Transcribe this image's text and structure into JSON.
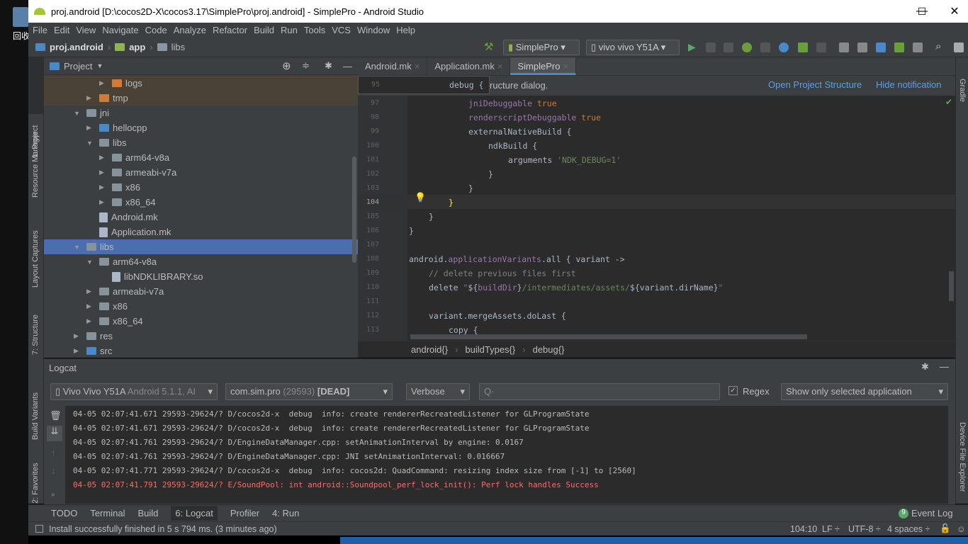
{
  "desktop": {
    "recycle_label": "回收"
  },
  "window": {
    "title": "proj.android [D:\\cocos2D-X\\cocos3.17\\SimplePro\\proj.android] - SimplePro - Android Studio",
    "minimize": "—",
    "maximize": "☐",
    "close": "✕"
  },
  "menu": [
    "File",
    "Edit",
    "View",
    "Navigate",
    "Code",
    "Analyze",
    "Refactor",
    "Build",
    "Run",
    "Tools",
    "VCS",
    "Window",
    "Help"
  ],
  "breadcrumb": [
    "proj.android",
    "app",
    "libs"
  ],
  "toolbar": {
    "config": "SimplePro",
    "device": "vivo vivo Y51A"
  },
  "left_strip": [
    "1: Project",
    "Resource Manager",
    "Layout Captures",
    "7: Structure",
    "Build Variants",
    "2: Favorites"
  ],
  "right_strip": [
    "Gradle",
    "Device File Explorer"
  ],
  "project_panel": {
    "title": "Project",
    "tree": [
      {
        "label": "logs",
        "depth": 2,
        "arrow": "▶",
        "type": "folder-orange"
      },
      {
        "label": "tmp",
        "depth": 1,
        "arrow": "▶",
        "type": "folder-orange"
      },
      {
        "label": "jni",
        "depth": 0,
        "arrow": "▼",
        "type": "folder"
      },
      {
        "label": "hellocpp",
        "depth": 1,
        "arrow": "▶",
        "type": "folder-blue"
      },
      {
        "label": "libs",
        "depth": 1,
        "arrow": "▼",
        "type": "folder"
      },
      {
        "label": "arm64-v8a",
        "depth": 2,
        "arrow": "▶",
        "type": "folder"
      },
      {
        "label": "armeabi-v7a",
        "depth": 2,
        "arrow": "▶",
        "type": "folder"
      },
      {
        "label": "x86",
        "depth": 2,
        "arrow": "▶",
        "type": "folder"
      },
      {
        "label": "x86_64",
        "depth": 2,
        "arrow": "▶",
        "type": "folder"
      },
      {
        "label": "Android.mk",
        "depth": 1,
        "arrow": "",
        "type": "file"
      },
      {
        "label": "Application.mk",
        "depth": 1,
        "arrow": "",
        "type": "file"
      },
      {
        "label": "libs",
        "depth": 0,
        "arrow": "▼",
        "type": "folder",
        "selected": true
      },
      {
        "label": "arm64-v8a",
        "depth": 1,
        "arrow": "▼",
        "type": "folder"
      },
      {
        "label": "libNDKLIBRARY.so",
        "depth": 2,
        "arrow": "",
        "type": "file"
      },
      {
        "label": "armeabi-v7a",
        "depth": 1,
        "arrow": "▶",
        "type": "folder"
      },
      {
        "label": "x86",
        "depth": 1,
        "arrow": "▶",
        "type": "folder"
      },
      {
        "label": "x86_64",
        "depth": 1,
        "arrow": "▶",
        "type": "folder"
      },
      {
        "label": "res",
        "depth": 0,
        "arrow": "▶",
        "type": "folder"
      },
      {
        "label": "src",
        "depth": 0,
        "arrow": "▶",
        "type": "folder-blue"
      }
    ]
  },
  "editor": {
    "tabs": [
      "Android.mk",
      "Application.mk",
      "SimplePro"
    ],
    "active_tab": 2,
    "notification": {
      "text": "ructure dialog.",
      "sticky_line": "95",
      "sticky_code": "debug {",
      "open": "Open Project Structure",
      "hide": "Hide notification"
    },
    "lines": [
      {
        "n": "97",
        "indent": 3,
        "html": "<span class='pr'>jniDebuggable</span> <span class='kw'>true</span>"
      },
      {
        "n": "98",
        "indent": 3,
        "html": "<span class='pr'>renderscriptDebuggable</span> <span class='kw'>true</span>"
      },
      {
        "n": "99",
        "indent": 3,
        "html": "externalNativeBuild {"
      },
      {
        "n": "100",
        "indent": 4,
        "html": "ndkBuild {"
      },
      {
        "n": "101",
        "indent": 5,
        "html": "arguments <span class='st'>'NDK_DEBUG=1'</span>"
      },
      {
        "n": "102",
        "indent": 4,
        "html": "}"
      },
      {
        "n": "103",
        "indent": 3,
        "html": "}"
      },
      {
        "n": "104",
        "indent": 2,
        "html": "<span style='color:#ffef28'>}</span>"
      },
      {
        "n": "105",
        "indent": 1,
        "html": "}"
      },
      {
        "n": "106",
        "indent": 0,
        "html": "}"
      },
      {
        "n": "107",
        "indent": 0,
        "html": ""
      },
      {
        "n": "108",
        "indent": 0,
        "html": "android.<span class='pr'>applicationVariants</span>.all { variant -&gt;"
      },
      {
        "n": "109",
        "indent": 1,
        "html": "<span class='cm'>// delete previous files first</span>"
      },
      {
        "n": "110",
        "indent": 1,
        "html": "delete <span class='st'>\"</span>${<span class='pr'>buildDir</span>}<span class='st'>/intermediates/assets/</span>${variant.dirName}<span class='st'>\"</span>"
      },
      {
        "n": "111",
        "indent": 0,
        "html": ""
      },
      {
        "n": "112",
        "indent": 1,
        "html": "variant.mergeAssets.doLast {"
      },
      {
        "n": "113",
        "indent": 2,
        "html": "copy {"
      }
    ],
    "crumbs": [
      "android{}",
      "buildTypes{}",
      "debug{}"
    ]
  },
  "logcat": {
    "title": "Logcat",
    "device": "Vivo Vivo Y51A",
    "device_detail": "Android 5.1.1, AI",
    "process": "com.sim.pro",
    "pid": "(29593)",
    "state": "[DEAD]",
    "level": "Verbose",
    "search_placeholder": "Q·",
    "regex_label": "Regex",
    "regex_checked": true,
    "filter": "Show only selected application",
    "lines": [
      {
        "text": "04-05 02:07:41.671 29593-29624/? D/cocos2d-x  debug  info: create rendererRecreatedListener for GLProgramState",
        "level": "D"
      },
      {
        "text": "04-05 02:07:41.671 29593-29624/? D/cocos2d-x  debug  info: create rendererRecreatedListener for GLProgramState",
        "level": "D"
      },
      {
        "text": "04-05 02:07:41.761 29593-29624/? D/EngineDataManager.cpp: setAnimationInterval by engine: 0.0167",
        "level": "D"
      },
      {
        "text": "04-05 02:07:41.761 29593-29624/? D/EngineDataManager.cpp: JNI setAnimationInterval: 0.016667",
        "level": "D"
      },
      {
        "text": "04-05 02:07:41.771 29593-29624/? D/cocos2d-x  debug  info: cocos2d: QuadCommand: resizing index size from [-1] to [2560]",
        "level": "D"
      },
      {
        "text": "04-05 02:07:41.791 29593-29624/? E/SoundPool: int android::Soundpool_perf_lock_init(): Perf lock handles Success",
        "level": "E"
      }
    ]
  },
  "tool_tabs": [
    "TODO",
    "Terminal",
    "Build",
    "6: Logcat",
    "Profiler",
    "4: Run"
  ],
  "event_log": {
    "count": "9",
    "label": "Event Log"
  },
  "status": {
    "message": "Install successfully finished in 5 s 794 ms. (3 minutes ago)",
    "position": "104:10",
    "line_sep": "LF ÷",
    "encoding": "UTF-8 ÷",
    "indent": "4 spaces ÷"
  },
  "colors": {
    "accent": "#4a88c7",
    "selection": "#4b6eaf",
    "error": "#ff6b68",
    "link": "#589df6"
  }
}
